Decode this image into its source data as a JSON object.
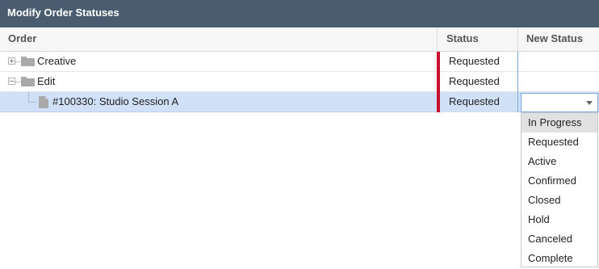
{
  "window": {
    "title": "Modify Order Statuses"
  },
  "columns": {
    "order": "Order",
    "status": "Status",
    "new_status": "New Status"
  },
  "rows": [
    {
      "label": "Creative",
      "status": "Requested",
      "status_color": "#c8102e"
    },
    {
      "label": "Edit",
      "status": "Requested",
      "status_color": "#c8102e"
    },
    {
      "label": "#100330: Studio Session A",
      "status": "Requested",
      "status_color": "#c8102e",
      "selected": true
    }
  ],
  "new_status_select": {
    "value": "",
    "options": [
      "In Progress",
      "Requested",
      "Active",
      "Confirmed",
      "Closed",
      "Hold",
      "Canceled",
      "Complete"
    ],
    "highlighted": "In Progress"
  },
  "colors": {
    "titlebar": "#4a5d70",
    "selection": "#cfe0f7",
    "status_marker": "#c8102e"
  }
}
